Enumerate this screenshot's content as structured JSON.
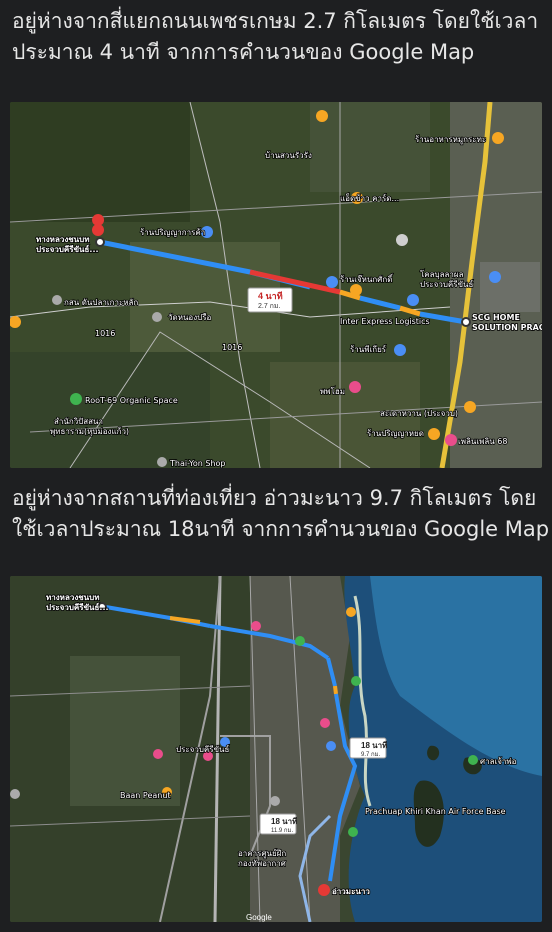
{
  "caption1": "อยู่ห่างจากสี่แยกถนนเพชรเกษม 2.7 กิโลเมตร โดยใช้เวลาประมาณ 4 นาที จากการคำนวนของ Google Map",
  "caption2": "อยู่ห่างจากสถานที่ท่องเที่ยว อ่าวมะนาว 9.7 กิโลเมตร โดยใช้เวลาประมาณ 18นาที จากการคำนวนของ Google Map",
  "map1": {
    "route_box": {
      "time": "4 นาที",
      "distance": "2.7 กม."
    },
    "labels": {
      "origin": "ทางหลวงชนบท",
      "origin2": "ประจวบคีรีขันธ์...",
      "destination": "SCG HOME",
      "destination2": "SOLUTION PRAC",
      "l1": "ร้านปริญญาการค้า",
      "l2": "ร้านเจ๊หนกศักดิ์",
      "l3": "Inter Express Logistics",
      "l4": "ร้านพีเกียร์",
      "l5": "วัดหนองปรือ",
      "l6": "กสน ดันปลาเกาะหลัก",
      "l7": "RooT-69 Organic Space",
      "l8": "สำนักวิปัสสนา",
      "l9": "พุทธาราม(หุบม่องแก้ว)",
      "l10": "Thai-Yon Shop",
      "l11": "พพโฮม",
      "l12": "สะเดาหวาน (ประจวบ)",
      "l13": "ร้านปริญญาหยด",
      "l14": "โคลบุลลาผล",
      "l15": "ประจวบคีรีขันธ์",
      "l16": "บ้านสวนรัวรัง",
      "l17": "แอ็ดข้าว คาร์ด...",
      "l18": "ร้านอาหารหมูกระทะ",
      "l19": "เพลินเพลิน 68",
      "l20": "1016",
      "l21": "1016"
    }
  },
  "map2": {
    "route_box_a": {
      "time": "18 นาที",
      "distance": "9.7 กม."
    },
    "route_box_b": {
      "time": "18 นาที",
      "distance": "11.9 กม."
    },
    "labels": {
      "origin": "ทางหลวงชนบท",
      "origin2": "ประจวบคีรีขันธ์...",
      "destination": "อ่าวมะนาว",
      "m1": "Baan Peanut",
      "m2": "Prachuap Khiri Khan Air Force Base",
      "m3": "อาคารศูนย์ฝึก",
      "m4": "กองทัพอากาศ",
      "m5": "ประจวบคีรีขันธ์",
      "m6": "ศาลเจ้าพ่อ",
      "m7": "Google"
    }
  }
}
